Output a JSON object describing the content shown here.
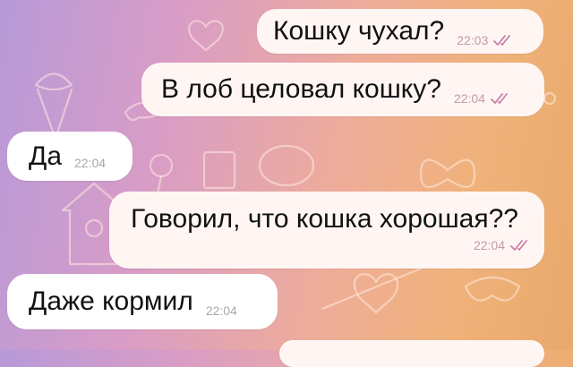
{
  "chat": {
    "messages": [
      {
        "text": "Кошку чухал?",
        "time": "22:03",
        "direction": "outgoing",
        "status": "read-checkmarks-icon"
      },
      {
        "text": "В лоб целовал кошку?",
        "time": "22:04",
        "direction": "outgoing",
        "status": "read-checkmarks-icon"
      },
      {
        "text": "Да",
        "time": "22:04",
        "direction": "incoming"
      },
      {
        "text": "Говорил, что кошка хорошая??",
        "time": "22:04",
        "direction": "outgoing",
        "status": "read-checkmarks-icon"
      },
      {
        "text": "Даже кормил",
        "time": "22:04",
        "direction": "incoming"
      }
    ]
  },
  "colors": {
    "outgoing_bubble": "#fff6f4",
    "incoming_bubble": "#ffffff",
    "wallpaper_start": "#b79ad8",
    "wallpaper_end": "#f0b27a",
    "checkmarks": "#c87fa8"
  }
}
